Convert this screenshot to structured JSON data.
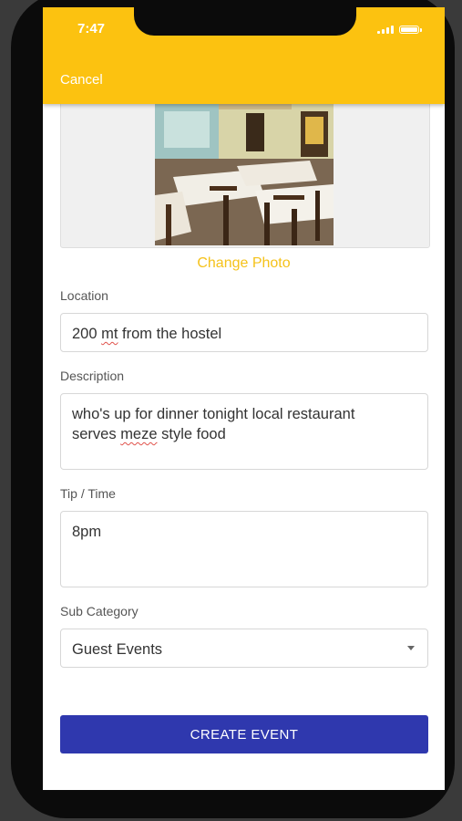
{
  "status_bar": {
    "time": "7:47"
  },
  "header": {
    "cancel_label": "Cancel",
    "accent_color": "#fcc210"
  },
  "photo": {
    "description_icon": "restaurant-photo",
    "change_label": "Change Photo"
  },
  "form": {
    "location": {
      "label": "Location",
      "value_prefix": "200 ",
      "value_misspelled": "mt",
      "value_suffix": " from the hostel"
    },
    "description": {
      "label": "Description",
      "line1": "who's up for dinner tonight local restaurant",
      "line2_prefix": "serves ",
      "line2_misspelled": "meze",
      "line2_suffix": " style food"
    },
    "tip_time": {
      "label": "Tip / Time",
      "value": "8pm"
    },
    "sub_category": {
      "label": "Sub Category",
      "selected": "Guest Events"
    }
  },
  "submit": {
    "label": "CREATE EVENT",
    "color": "#2f38ae"
  }
}
